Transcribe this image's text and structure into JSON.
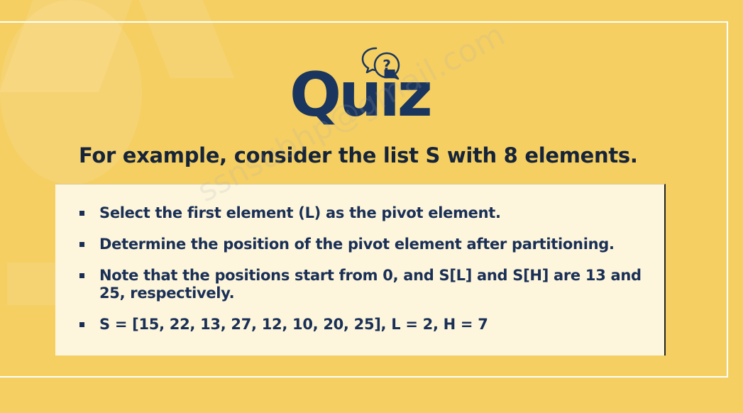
{
  "quiz": {
    "title": "Quiz",
    "icon": "question-speech-bubbles-icon"
  },
  "headline": "For example, consider the list S with 8 elements.",
  "bullets": [
    "Select the first element (L) as the pivot element.",
    "Determine the position of the pivot element after partitioning.",
    "Note that the positions start from 0, and S[L] and S[H] are 13 and 25, respectively.",
    "S = [15, 22, 13, 27, 12, 10, 20, 25], L = 2, H = 7"
  ],
  "watermark": "ssnsubhp@gmail.com",
  "colors": {
    "background": "#f5cf62",
    "navy": "#1a355e",
    "card": "#fdf6dc",
    "frame": "#ffffff"
  }
}
